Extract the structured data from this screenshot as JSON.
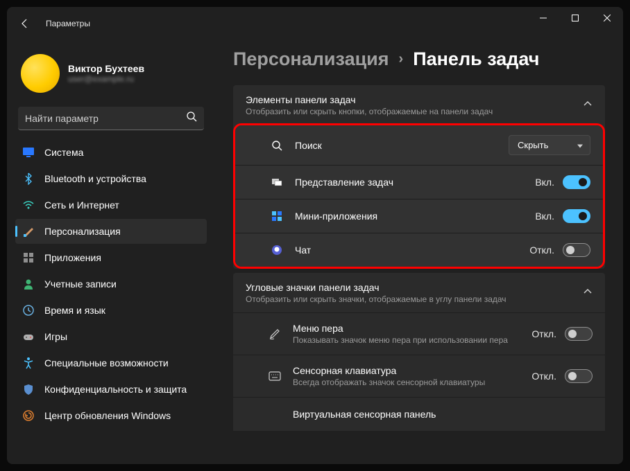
{
  "app_title": "Параметры",
  "user": {
    "name": "Виктор Бухтеев",
    "email": "user@example.ru"
  },
  "search": {
    "placeholder": "Найти параметр"
  },
  "nav": [
    {
      "id": "system",
      "label": "Система",
      "icon": "monitor"
    },
    {
      "id": "bluetooth",
      "label": "Bluetooth и устройства",
      "icon": "bluetooth"
    },
    {
      "id": "network",
      "label": "Сеть и Интернет",
      "icon": "wifi"
    },
    {
      "id": "personalization",
      "label": "Персонализация",
      "icon": "brush",
      "active": true
    },
    {
      "id": "apps",
      "label": "Приложения",
      "icon": "grid"
    },
    {
      "id": "accounts",
      "label": "Учетные записи",
      "icon": "person"
    },
    {
      "id": "time",
      "label": "Время и язык",
      "icon": "clock"
    },
    {
      "id": "gaming",
      "label": "Игры",
      "icon": "gamepad"
    },
    {
      "id": "accessibility",
      "label": "Специальные возможности",
      "icon": "accessibility"
    },
    {
      "id": "privacy",
      "label": "Конфиденциальность и защита",
      "icon": "shield"
    },
    {
      "id": "update",
      "label": "Центр обновления Windows",
      "icon": "update"
    }
  ],
  "breadcrumbs": {
    "root": "Персонализация",
    "current": "Панель задач"
  },
  "section1": {
    "title": "Элементы панели задач",
    "subtitle": "Отобразить или скрыть кнопки, отображаемые на панели задач",
    "rows": [
      {
        "id": "search",
        "label": "Поиск",
        "control": "dropdown",
        "value": "Скрыть"
      },
      {
        "id": "taskview",
        "label": "Представление задач",
        "control": "toggle",
        "state": "Вкл.",
        "on": true
      },
      {
        "id": "widgets",
        "label": "Мини-приложения",
        "control": "toggle",
        "state": "Вкл.",
        "on": true
      },
      {
        "id": "chat",
        "label": "Чат",
        "control": "toggle",
        "state": "Откл.",
        "on": false
      }
    ]
  },
  "section2": {
    "title": "Угловые значки панели задач",
    "subtitle": "Отобразить или скрыть значки, отображаемые в углу панели задач",
    "rows": [
      {
        "id": "pen",
        "label": "Меню пера",
        "desc": "Показывать значок меню пера при использовании пера",
        "state": "Откл.",
        "on": false
      },
      {
        "id": "touchkb",
        "label": "Сенсорная клавиатура",
        "desc": "Всегда отображать значок сенсорной клавиатуры",
        "state": "Откл.",
        "on": false
      },
      {
        "id": "touchpad",
        "label": "Виртуальная сенсорная панель",
        "desc": "",
        "state": "",
        "on": false
      }
    ]
  }
}
